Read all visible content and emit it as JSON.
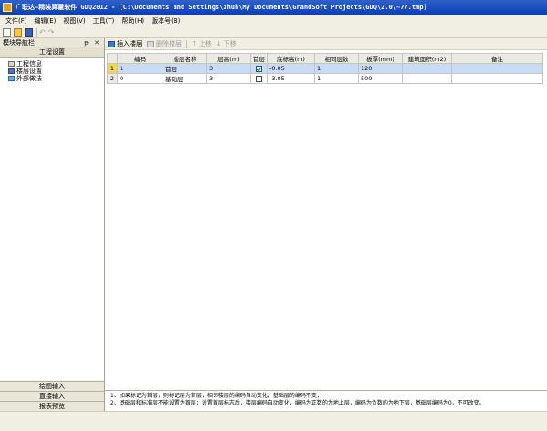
{
  "window": {
    "title": "广联达—精装算量软件 GDQ2012 - [C:\\Documents and Settings\\zhuh\\My Documents\\GrandSoft Projects\\GDQ\\2.0\\~77.tmp]"
  },
  "menu": {
    "items": [
      "文件(F)",
      "编辑(E)",
      "视图(V)",
      "工具(T)",
      "帮助(H)",
      "版本号(B)"
    ]
  },
  "quickbar": {
    "undo_icon": "↶",
    "redo_icon": "↷"
  },
  "left_panel": {
    "title": "模块导航栏",
    "controls": "ᵽ ✕",
    "tab": "工程设置",
    "tree": [
      "工程信息",
      "楼层设置",
      "外部做法"
    ],
    "bottom_tabs": [
      "绘图输入",
      "直接输入",
      "报表预览"
    ]
  },
  "toolbar": {
    "insert": "插入楼层",
    "delete": "删除楼层",
    "up": "上移",
    "down": "下移",
    "up_icon": "↑",
    "down_icon": "↓"
  },
  "grid": {
    "columns": [
      "",
      "编码",
      "楼层名称",
      "层高(m)",
      "首层",
      "底标高(m)",
      "相同层数",
      "板厚(mm)",
      "建筑面积(m2)",
      "备注"
    ],
    "rows": [
      {
        "no": "1",
        "code": "1",
        "name": "首层",
        "height": "3",
        "first": true,
        "bottom": "-0.05",
        "same": "1",
        "thick": "120",
        "area": "",
        "note": ""
      },
      {
        "no": "2",
        "code": "0",
        "name": "基础层",
        "height": "3",
        "first": false,
        "bottom": "-3.05",
        "same": "1",
        "thick": "500",
        "area": "",
        "note": ""
      }
    ]
  },
  "notes": {
    "line1": "1、如果标记为首层，则标记层为首层，相邻楼层的编码自动变化，基础层的编码不变；",
    "line2": "2、基础层和标准层不能设置为首层；设置首层标志后，楼层编码自动变化，编码为正数的为地上层，编码为负数的为地下层，基础层编码为0，不可改变。"
  },
  "colors": {
    "titlebar": "#0a3fb8",
    "selected_row": "#c9dcf5",
    "row_indicator": "#f7d35b"
  }
}
